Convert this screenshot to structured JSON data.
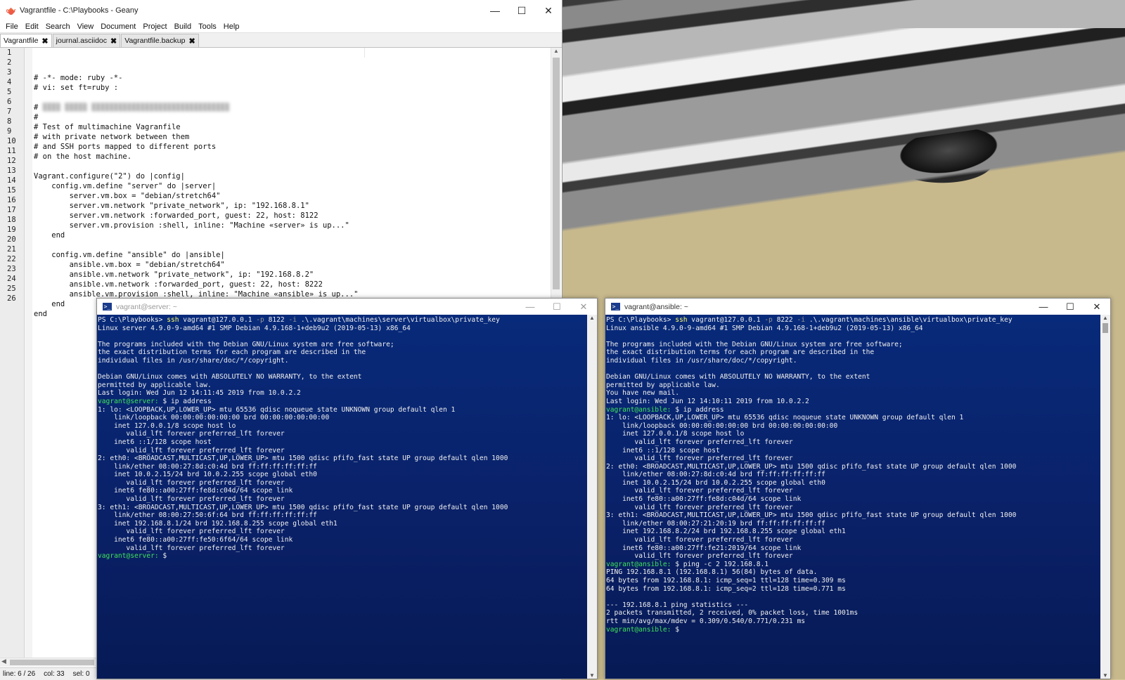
{
  "geany": {
    "title": "Vagrantfile - C:\\Playbooks - Geany",
    "menu": [
      "File",
      "Edit",
      "Search",
      "View",
      "Document",
      "Project",
      "Build",
      "Tools",
      "Help"
    ],
    "tabs": [
      {
        "label": "Vagrantfile",
        "active": true
      },
      {
        "label": "journal.asciidoc",
        "active": false
      },
      {
        "label": "Vagrantfile.backup",
        "active": false
      }
    ],
    "lines": [
      "# -*- mode: ruby -*-",
      "# vi: set ft=ruby :",
      "",
      "#",
      "#",
      "# Test of multimachine Vagranfile",
      "# with private network between them",
      "# and SSH ports mapped to different ports",
      "# on the host machine.",
      "",
      "Vagrant.configure(\"2\") do |config|",
      "    config.vm.define \"server\" do |server|",
      "        server.vm.box = \"debian/stretch64\"",
      "        server.vm.network \"private_network\", ip: \"192.168.8.1\"",
      "        server.vm.network :forwarded_port, guest: 22, host: 8122",
      "        server.vm.provision :shell, inline: \"Machine «server» is up...\"",
      "    end",
      "",
      "    config.vm.define \"ansible\" do |ansible|",
      "        ansible.vm.box = \"debian/stretch64\"",
      "        ansible.vm.network \"private_network\", ip: \"192.168.8.2\"",
      "        ansible.vm.network :forwarded_port, guest: 22, host: 8222",
      "        ansible.vm.provision :shell, inline: \"Machine «ansible» is up...\"",
      "    end",
      "end",
      ""
    ],
    "status": {
      "line": "line: 6 / 26",
      "col": "col: 33",
      "sel": "sel: 0"
    }
  },
  "terminals": {
    "server": {
      "title": "vagrant@server: ~",
      "lines": [
        "PS C:\\Playbooks> ssh vagrant@127.0.0.1 -p 8122 -i .\\.vagrant\\machines\\server\\virtualbox\\private_key",
        "Linux server 4.9.0-9-amd64 #1 SMP Debian 4.9.168-1+deb9u2 (2019-05-13) x86_64",
        "",
        "The programs included with the Debian GNU/Linux system are free software;",
        "the exact distribution terms for each program are described in the",
        "individual files in /usr/share/doc/*/copyright.",
        "",
        "Debian GNU/Linux comes with ABSOLUTELY NO WARRANTY, to the extent",
        "permitted by applicable law.",
        "Last login: Wed Jun 12 14:11:45 2019 from 10.0.2.2",
        "vagrant@server: $ ip address",
        "1: lo: <LOOPBACK,UP,LOWER_UP> mtu 65536 qdisc noqueue state UNKNOWN group default qlen 1",
        "    link/loopback 00:00:00:00:00:00 brd 00:00:00:00:00:00",
        "    inet 127.0.0.1/8 scope host lo",
        "       valid_lft forever preferred_lft forever",
        "    inet6 ::1/128 scope host",
        "       valid_lft forever preferred_lft forever",
        "2: eth0: <BROADCAST,MULTICAST,UP,LOWER_UP> mtu 1500 qdisc pfifo_fast state UP group default qlen 1000",
        "    link/ether 08:00:27:8d:c0:4d brd ff:ff:ff:ff:ff:ff",
        "    inet 10.0.2.15/24 brd 10.0.2.255 scope global eth0",
        "       valid_lft forever preferred_lft forever",
        "    inet6 fe80::a00:27ff:fe8d:c04d/64 scope link",
        "       valid_lft forever preferred_lft forever",
        "3: eth1: <BROADCAST,MULTICAST,UP,LOWER_UP> mtu 1500 qdisc pfifo_fast state UP group default qlen 1000",
        "    link/ether 08:00:27:50:6f:64 brd ff:ff:ff:ff:ff:ff",
        "    inet 192.168.8.1/24 brd 192.168.8.255 scope global eth1",
        "       valid_lft forever preferred_lft forever",
        "    inet6 fe80::a00:27ff:fe50:6f64/64 scope link",
        "       valid_lft forever preferred_lft forever",
        "vagrant@server: $"
      ]
    },
    "ansible": {
      "title": "vagrant@ansible: ~",
      "lines": [
        "PS C:\\Playbooks> ssh vagrant@127.0.0.1 -p 8222 -i .\\.vagrant\\machines\\ansible\\virtualbox\\private_key",
        "Linux ansible 4.9.0-9-amd64 #1 SMP Debian 4.9.168-1+deb9u2 (2019-05-13) x86_64",
        "",
        "The programs included with the Debian GNU/Linux system are free software;",
        "the exact distribution terms for each program are described in the",
        "individual files in /usr/share/doc/*/copyright.",
        "",
        "Debian GNU/Linux comes with ABSOLUTELY NO WARRANTY, to the extent",
        "permitted by applicable law.",
        "You have new mail.",
        "Last login: Wed Jun 12 14:10:11 2019 from 10.0.2.2",
        "vagrant@ansible: $ ip address",
        "1: lo: <LOOPBACK,UP,LOWER_UP> mtu 65536 qdisc noqueue state UNKNOWN group default qlen 1",
        "    link/loopback 00:00:00:00:00:00 brd 00:00:00:00:00:00",
        "    inet 127.0.0.1/8 scope host lo",
        "       valid_lft forever preferred_lft forever",
        "    inet6 ::1/128 scope host",
        "       valid_lft forever preferred_lft forever",
        "2: eth0: <BROADCAST,MULTICAST,UP,LOWER_UP> mtu 1500 qdisc pfifo_fast state UP group default qlen 1000",
        "    link/ether 08:00:27:8d:c0:4d brd ff:ff:ff:ff:ff:ff",
        "    inet 10.0.2.15/24 brd 10.0.2.255 scope global eth0",
        "       valid_lft forever preferred_lft forever",
        "    inet6 fe80::a00:27ff:fe8d:c04d/64 scope link",
        "       valid_lft forever preferred_lft forever",
        "3: eth1: <BROADCAST,MULTICAST,UP,LOWER_UP> mtu 1500 qdisc pfifo_fast state UP group default qlen 1000",
        "    link/ether 08:00:27:21:20:19 brd ff:ff:ff:ff:ff:ff",
        "    inet 192.168.8.2/24 brd 192.168.8.255 scope global eth1",
        "       valid_lft forever preferred_lft forever",
        "    inet6 fe80::a00:27ff:fe21:2019/64 scope link",
        "       valid_lft forever preferred_lft forever",
        "vagrant@ansible: $ ping -c 2 192.168.8.1",
        "PING 192.168.8.1 (192.168.8.1) 56(84) bytes of data.",
        "64 bytes from 192.168.8.1: icmp_seq=1 ttl=128 time=0.309 ms",
        "64 bytes from 192.168.8.1: icmp_seq=2 ttl=128 time=0.771 ms",
        "",
        "--- 192.168.8.1 ping statistics ---",
        "2 packets transmitted, 2 received, 0% packet loss, time 1001ms",
        "rtt min/avg/max/mdev = 0.309/0.540/0.771/0.231 ms",
        "vagrant@ansible: $"
      ]
    }
  },
  "icons": {
    "minimize": "minimize-icon",
    "maximize": "maximize-icon",
    "close": "close-icon",
    "tab_close": "tab-close-icon",
    "powershell": "powershell-icon",
    "geany": "geany-icon"
  },
  "colors": {
    "terminal_bg": "#0a2066",
    "prompt": "#3fe35a",
    "command_highlight": "#ffff66"
  }
}
